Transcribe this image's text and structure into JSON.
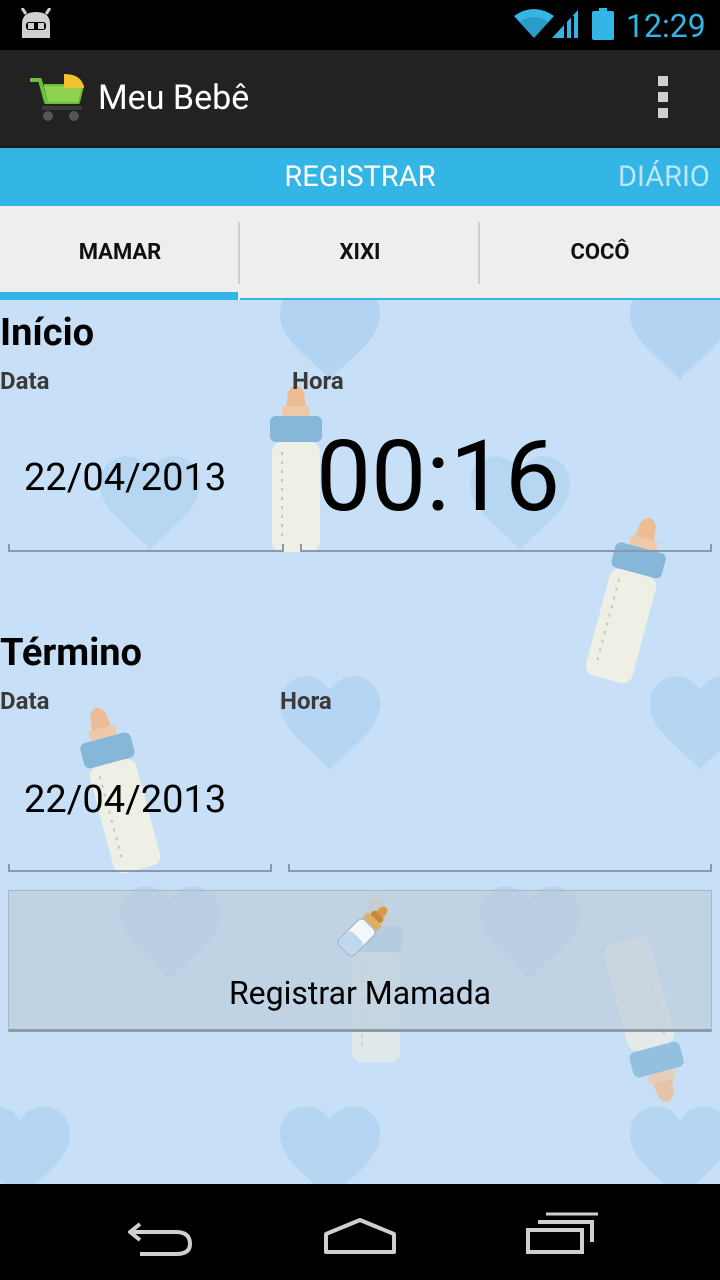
{
  "status_bar": {
    "time": "12:29",
    "icons": [
      "android-icon",
      "wifi-icon",
      "signal-icon",
      "battery-icon"
    ]
  },
  "action_bar": {
    "title": "Meu Bebê",
    "app_icon": "stroller-icon",
    "menu_icon": "overflow-menu-icon"
  },
  "top_tabs": [
    {
      "label": "REGISTRAR",
      "selected": true
    },
    {
      "label": "DIÁRIO",
      "selected": false
    }
  ],
  "sub_tabs": [
    {
      "label": "MAMAR",
      "selected": true
    },
    {
      "label": "XIXI",
      "selected": false
    },
    {
      "label": "COCÔ",
      "selected": false
    }
  ],
  "inicio": {
    "title": "Início",
    "date_label": "Data",
    "time_label": "Hora",
    "date_value": "22/04/2013",
    "time_value": "00:16"
  },
  "termino": {
    "title": "Término",
    "date_label": "Data",
    "time_label": "Hora",
    "date_value": "22/04/2013",
    "time_value": ""
  },
  "register_button": {
    "label": "Registrar Mamada",
    "icon": "baby-bottle-icon"
  },
  "nav_bar": {
    "icons": [
      "back-icon",
      "home-icon",
      "recent-apps-icon"
    ]
  },
  "colors": {
    "accent": "#33b5e5",
    "action_bar": "#222222",
    "content_bg": "#c7e0f7",
    "sub_tabs_bg": "#eeeeee"
  }
}
